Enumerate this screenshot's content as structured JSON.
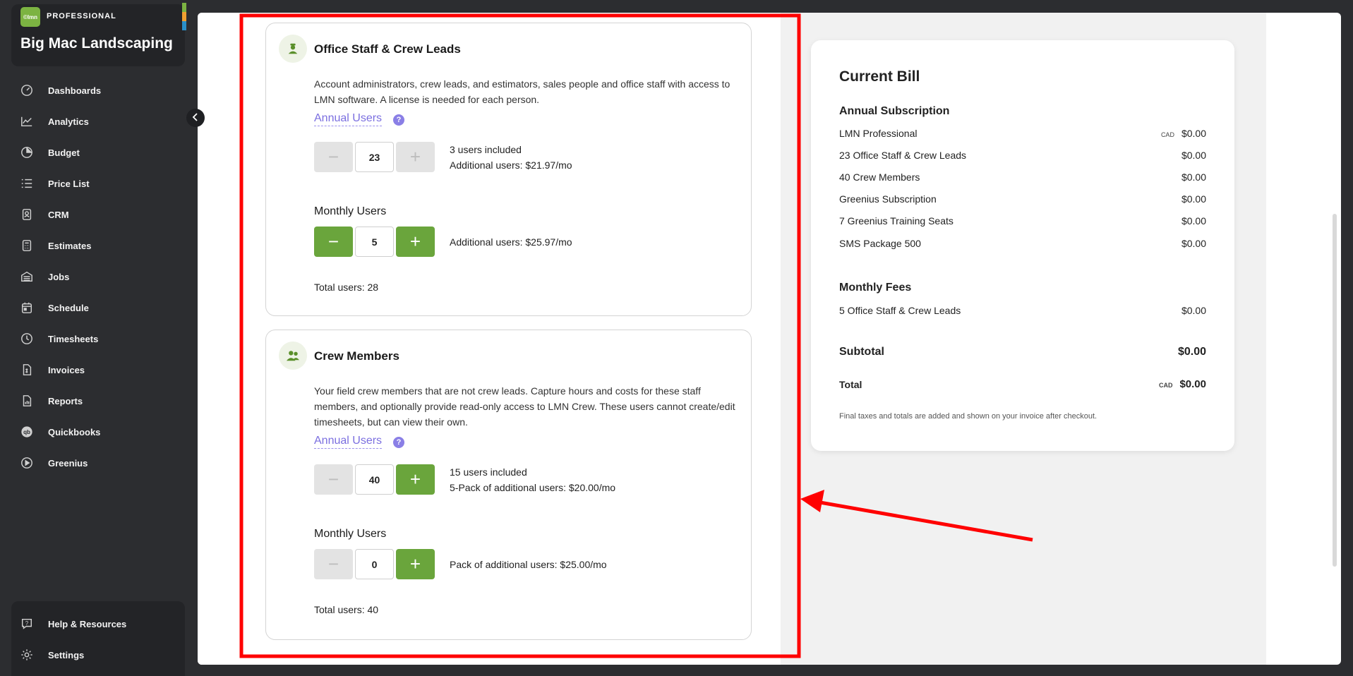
{
  "brand": {
    "logo": "©lmn",
    "tier": "PROFESSIONAL",
    "name": "Big Mac Landscaping",
    "stripe_colors": [
      "#7cb342",
      "#f0a030",
      "#2a8fc8"
    ]
  },
  "nav": [
    {
      "label": "Dashboards",
      "icon": "gauge-icon"
    },
    {
      "label": "Analytics",
      "icon": "line-chart-icon"
    },
    {
      "label": "Budget",
      "icon": "pie-chart-icon"
    },
    {
      "label": "Price List",
      "icon": "list-icon"
    },
    {
      "label": "CRM",
      "icon": "contact-icon"
    },
    {
      "label": "Estimates",
      "icon": "calculator-icon"
    },
    {
      "label": "Jobs",
      "icon": "garage-icon"
    },
    {
      "label": "Schedule",
      "icon": "calendar-icon"
    },
    {
      "label": "Timesheets",
      "icon": "clock-icon"
    },
    {
      "label": "Invoices",
      "icon": "invoice-icon"
    },
    {
      "label": "Reports",
      "icon": "report-icon"
    },
    {
      "label": "Quickbooks",
      "icon": "quickbooks-icon"
    },
    {
      "label": "Greenius",
      "icon": "play-circle-icon"
    }
  ],
  "nav_bottom": [
    {
      "label": "Help & Resources",
      "icon": "help-icon"
    },
    {
      "label": "Settings",
      "icon": "gear-icon"
    }
  ],
  "office": {
    "title": "Office Staff & Crew Leads",
    "description": "Account administrators, crew leads, and estimators, sales people and office staff with access to LMN software. A license is needed for each person.",
    "annual_label": "Annual Users",
    "annual_value": "23",
    "annual_info_1": "3 users included",
    "annual_info_2": "Additional users: $21.97/mo",
    "monthly_label": "Monthly Users",
    "monthly_value": "5",
    "monthly_info": "Additional users: $25.97/mo",
    "total": "Total users: 28"
  },
  "crew": {
    "title": "Crew Members",
    "description": "Your field crew members that are not crew leads. Capture hours and costs for these staff members, and optionally provide read-only access to LMN Crew. These users cannot create/edit timesheets, but can view their own.",
    "annual_label": "Annual Users",
    "annual_value": "40",
    "annual_info_1": "15 users included",
    "annual_info_2": "5-Pack of additional users: $20.00/mo",
    "monthly_label": "Monthly Users",
    "monthly_value": "0",
    "monthly_info": "Pack of additional users: $25.00/mo",
    "total": "Total users: 40"
  },
  "bill": {
    "title": "Current Bill",
    "annual_heading": "Annual Subscription",
    "annual_items": [
      {
        "label": "LMN Professional",
        "currency": "CAD",
        "amount": "$0.00"
      },
      {
        "label": "23 Office Staff & Crew Leads",
        "currency": "",
        "amount": "$0.00"
      },
      {
        "label": "40 Crew Members",
        "currency": "",
        "amount": "$0.00"
      },
      {
        "label": "Greenius Subscription",
        "currency": "",
        "amount": "$0.00"
      },
      {
        "label": "7 Greenius Training Seats",
        "currency": "",
        "amount": "$0.00"
      },
      {
        "label": "SMS Package 500",
        "currency": "",
        "amount": "$0.00"
      }
    ],
    "monthly_heading": "Monthly Fees",
    "monthly_items": [
      {
        "label": "5 Office Staff & Crew Leads",
        "amount": "$0.00"
      }
    ],
    "subtotal_label": "Subtotal",
    "subtotal": "$0.00",
    "total_label": "Total",
    "total_currency": "CAD",
    "total": "$0.00",
    "note": "Final taxes and totals are added and shown on your invoice after checkout."
  },
  "controls": {
    "minus": "−",
    "plus": "+",
    "help": "?"
  },
  "colors": {
    "accent_green": "#6aa53c",
    "annual_label": "#7b6fe0",
    "annotation_red": "#ff0000"
  }
}
